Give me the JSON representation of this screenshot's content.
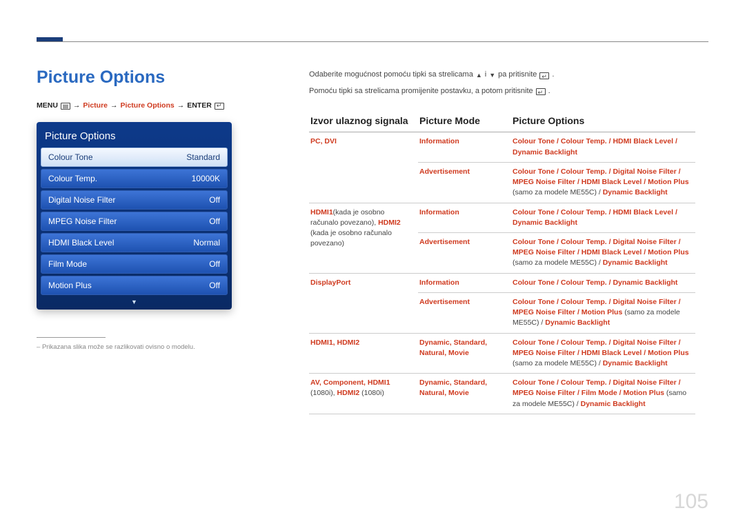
{
  "doc": {
    "title": "Picture Options",
    "page_number": "105",
    "footnote": "Prikazana slika može se razlikovati ovisno o modelu."
  },
  "breadcrumb": {
    "menu": "MENU",
    "picture": "Picture",
    "picture_options": "Picture Options",
    "enter": "ENTER",
    "arrow": "→"
  },
  "intro": {
    "line1a": "Odaberite mogućnost pomoću tipki sa strelicama",
    "line1b": "i",
    "line1c": "pa pritisnite",
    "line1d": ".",
    "line2a": "Pomoću tipki sa strelicama promijenite postavku, a potom pritisnite",
    "line2b": "."
  },
  "panel": {
    "title": "Picture Options",
    "rows": [
      {
        "label": "Colour Tone",
        "value": "Standard",
        "selected": true
      },
      {
        "label": "Colour Temp.",
        "value": "10000K",
        "selected": false
      },
      {
        "label": "Digital Noise Filter",
        "value": "Off",
        "selected": false
      },
      {
        "label": "MPEG Noise Filter",
        "value": "Off",
        "selected": false
      },
      {
        "label": "HDMI Black Level",
        "value": "Normal",
        "selected": false
      },
      {
        "label": "Film Mode",
        "value": "Off",
        "selected": false
      },
      {
        "label": "Motion Plus",
        "value": "Off",
        "selected": false
      }
    ]
  },
  "table": {
    "headers": {
      "source": "Izvor ulaznog signala",
      "mode": "Picture Mode",
      "options": "Picture Options"
    },
    "note_me55c": "(samo za modele ME55C) / ",
    "note_me55c_paren": " (samo za modele ME55C) / ",
    "source": {
      "pc_dvi": "PC, DVI",
      "hdmi1_note": "HDMI1(kada je osobno računalo povezano), HDMI2 (kada je osobno računalo povezano)",
      "displayport": "DisplayPort",
      "hdmi12": "HDMI1, HDMI2",
      "av_comp": "AV, Component, HDMI1 (1080i), HDMI2 (1080i)"
    },
    "modes": {
      "information": "Information",
      "advertisement": "Advertisement",
      "dynamic": "Dynamic",
      "standard": "Standard",
      "natural": "Natural",
      "movie": "Movie"
    },
    "opts": {
      "colour_tone": "Colour Tone",
      "colour_temp": "Colour Temp.",
      "hdmi_black": "HDMI Black Level",
      "dynamic_backlight": "Dynamic Backlight",
      "digital_noise": "Digital Noise Filter",
      "mpeg_noise": "MPEG Noise Filter",
      "motion_plus": "Motion Plus",
      "film_mode": "Film Mode"
    }
  }
}
